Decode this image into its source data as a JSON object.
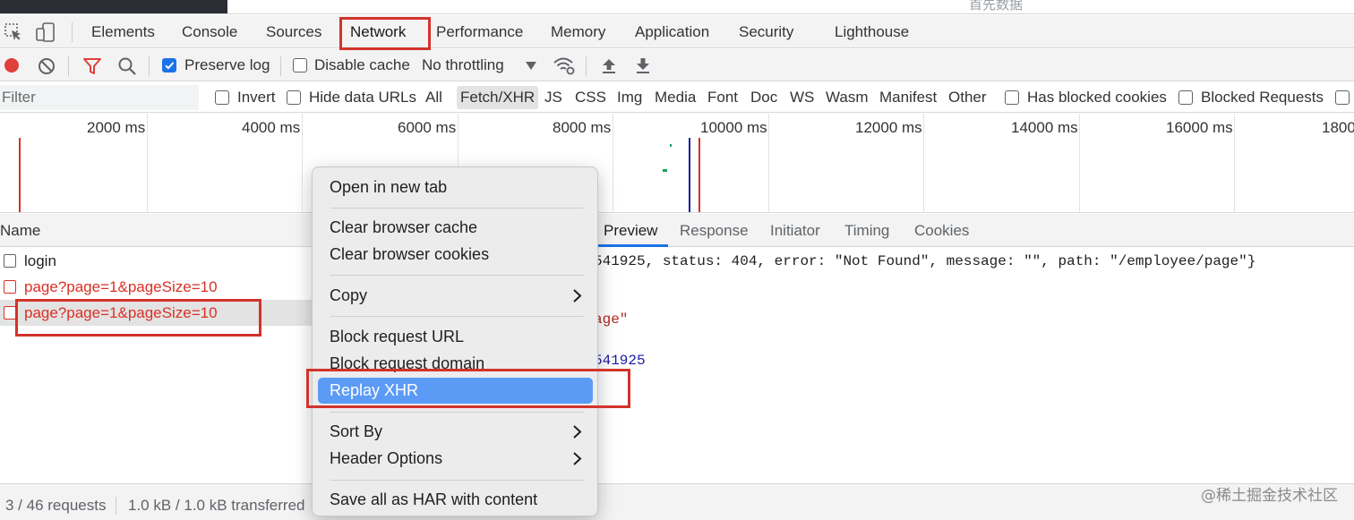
{
  "page_strip": {
    "ghost_text": "首先数据"
  },
  "main_tabs": [
    {
      "label": "Elements"
    },
    {
      "label": "Console"
    },
    {
      "label": "Sources"
    },
    {
      "label": "Network",
      "active": true
    },
    {
      "label": "Performance"
    },
    {
      "label": "Memory"
    },
    {
      "label": "Application"
    },
    {
      "label": "Security"
    },
    {
      "label": "Lighthouse"
    }
  ],
  "toolbar": {
    "preserve_log_label": "Preserve log",
    "preserve_log_checked": true,
    "disable_cache_label": "Disable cache",
    "disable_cache_checked": false,
    "throttling_value": "No throttling",
    "icons": [
      "record-icon",
      "clear-icon",
      "filter-icon",
      "search-icon",
      "caret-down-icon",
      "wifi-settings-icon",
      "import-icon",
      "export-icon"
    ]
  },
  "filter_bar": {
    "placeholder": "Filter",
    "invert_label": "Invert",
    "hide_data_urls_label": "Hide data URLs",
    "types": [
      "All",
      "Fetch/XHR",
      "JS",
      "CSS",
      "Img",
      "Media",
      "Font",
      "Doc",
      "WS",
      "Wasm",
      "Manifest",
      "Other"
    ],
    "active_type": "Fetch/XHR",
    "blocked_cookies_label": "Has blocked cookies",
    "blocked_requests_label": "Blocked Requests"
  },
  "timeline": {
    "ticks": [
      "2000 ms",
      "4000 ms",
      "6000 ms",
      "8000 ms",
      "10000 ms",
      "12000 ms",
      "14000 ms",
      "16000 ms",
      "1800"
    ]
  },
  "request_list": {
    "header": "Name",
    "rows": [
      {
        "name": "login",
        "status": "ok"
      },
      {
        "name": "page?page=1&pageSize=10",
        "status": "error"
      },
      {
        "name": "page?page=1&pageSize=10",
        "status": "error",
        "selected": true
      }
    ]
  },
  "detail_tabs": [
    "Preview",
    "Response",
    "Initiator",
    "Timing",
    "Cookies"
  ],
  "detail_active_tab": "Preview",
  "detail_preview": {
    "line1": "541925, status: 404, error: \"Not Found\", message: \"\", path: \"/employee/page\"}",
    "line2": "age\"",
    "line3": "541925"
  },
  "context_menu": {
    "items": [
      {
        "label": "Open in new tab"
      },
      {
        "label": "Clear browser cache"
      },
      {
        "label": "Clear browser cookies"
      },
      {
        "label": "Copy",
        "submenu": true
      },
      {
        "label": "Block request URL"
      },
      {
        "label": "Block request domain"
      },
      {
        "label": "Replay XHR",
        "highlighted": true
      },
      {
        "label": "Sort By",
        "submenu": true
      },
      {
        "label": "Header Options",
        "submenu": true
      },
      {
        "label": "Save all as HAR with content"
      }
    ]
  },
  "status_bar": {
    "requests": "3 / 46 requests",
    "transferred": "1.0 kB / 1.0 kB transferred"
  },
  "watermark": "@稀土掘金技术社区",
  "colors": {
    "accent": "#1a73e8",
    "error": "#d93025",
    "record": "#e0403a",
    "annotation": "#d2332b",
    "menu_highlight": "#5c9bf5"
  }
}
